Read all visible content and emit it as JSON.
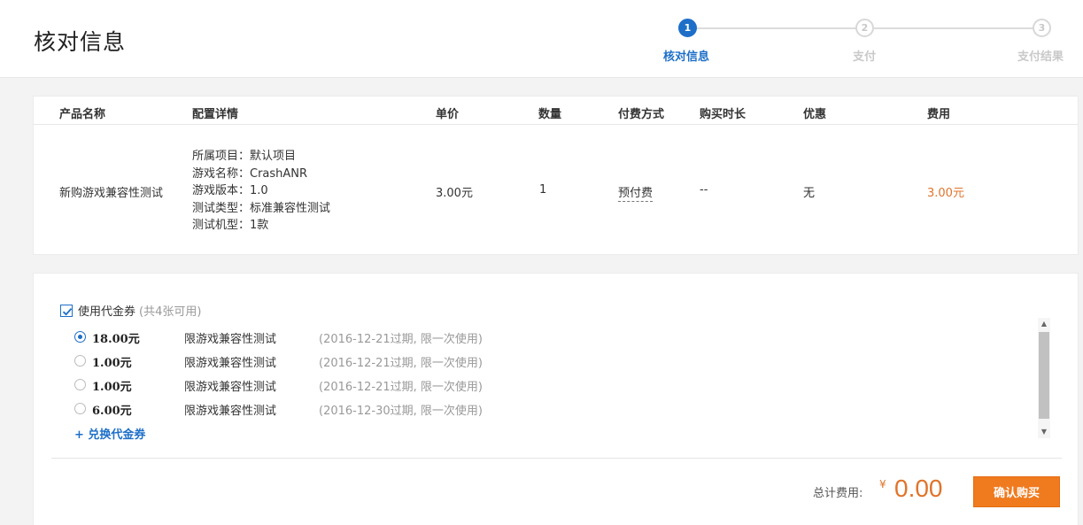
{
  "header": {
    "title": "核对信息"
  },
  "steps": [
    {
      "num": "1",
      "label": "核对信息",
      "active": true
    },
    {
      "num": "2",
      "label": "支付",
      "active": false
    },
    {
      "num": "3",
      "label": "支付结果",
      "active": false
    }
  ],
  "order": {
    "columns": {
      "product": "产品名称",
      "config": "配置详情",
      "unit_price": "单价",
      "quantity": "数量",
      "payment": "付费方式",
      "duration": "购买时长",
      "discount": "优惠",
      "fee": "费用"
    },
    "row": {
      "product": "新购游戏兼容性测试",
      "config": [
        "所属项目：默认项目",
        "游戏名称：CrashANR",
        "游戏版本：1.0",
        "测试类型：标准兼容性测试",
        "测试机型：1款"
      ],
      "unit_price": "3.00元",
      "quantity": "1",
      "payment": "预付费",
      "duration": "--",
      "discount": "无",
      "fee": "3.00元"
    }
  },
  "coupons": {
    "use_label": "使用代金券",
    "count_text": "(共4张可用)",
    "checked": true,
    "items": [
      {
        "amount": "18.00元",
        "scope": "限游戏兼容性测试",
        "expire": "(2016-12-21过期, 限一次使用)",
        "selected": true
      },
      {
        "amount": "1.00元",
        "scope": "限游戏兼容性测试",
        "expire": "(2016-12-21过期, 限一次使用)",
        "selected": false
      },
      {
        "amount": "1.00元",
        "scope": "限游戏兼容性测试",
        "expire": "(2016-12-21过期, 限一次使用)",
        "selected": false
      },
      {
        "amount": "6.00元",
        "scope": "限游戏兼容性测试",
        "expire": "(2016-12-30过期, 限一次使用)",
        "selected": false
      }
    ],
    "redeem_label": "+ 兑换代金券"
  },
  "summary": {
    "total_label": "总计费用:",
    "currency": "¥",
    "total_value": "0.00",
    "confirm_label": "确认购买"
  },
  "colors": {
    "primary": "#1e6fc8",
    "accent": "#f07a1e",
    "price": "#e0742b"
  },
  "icons": {
    "checkbox": "checkmark-icon",
    "scroll_up": "triangle-up-icon",
    "scroll_down": "triangle-down-icon"
  }
}
